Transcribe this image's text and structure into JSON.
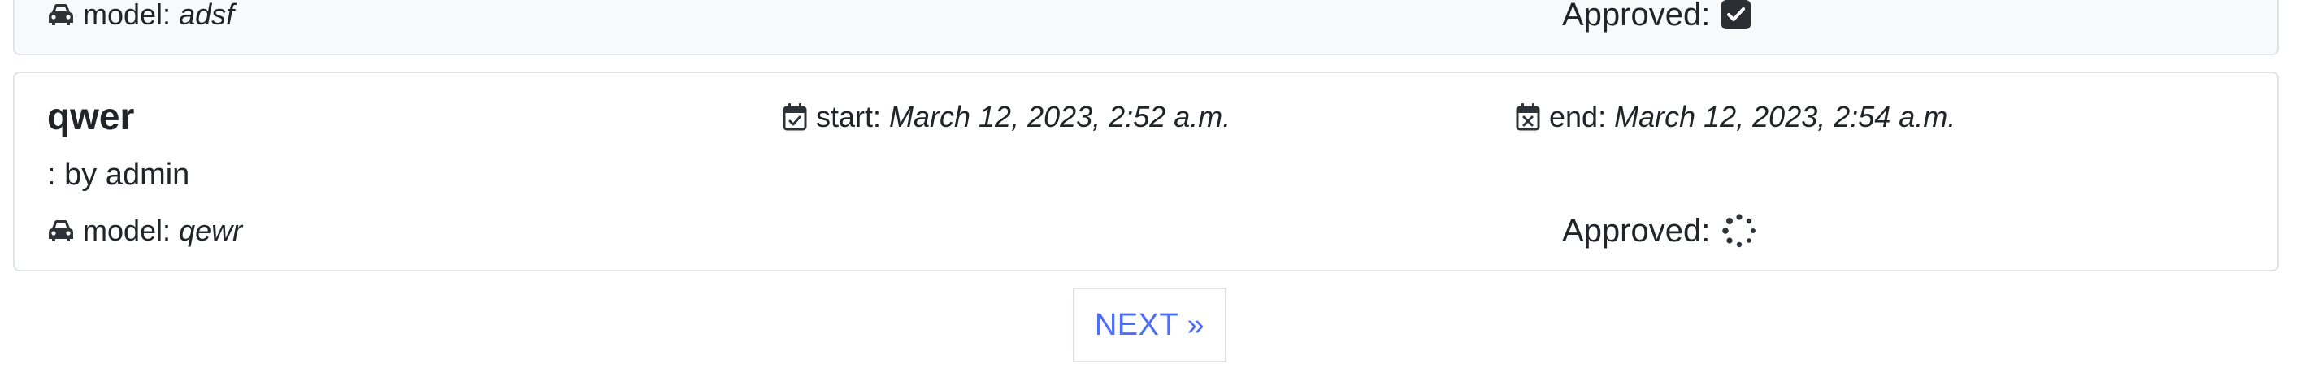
{
  "prev_item": {
    "model_label": "model:",
    "model_value": "adsf",
    "approved_label": "Approved:",
    "approved_state": "checked"
  },
  "item": {
    "title": "qwer",
    "start_label": "start:",
    "start_value": "March 12, 2023, 2:52 a.m.",
    "end_label": "end:",
    "end_value": "March 12, 2023, 2:54 a.m.",
    "byline": ": by admin",
    "model_label": "model:",
    "model_value": "qewr",
    "approved_label": "Approved:",
    "approved_state": "pending"
  },
  "pagination": {
    "next_label": "NEXT »"
  },
  "icons": {
    "car": "car-icon",
    "calendar_check": "calendar-check-icon",
    "calendar_x": "calendar-x-icon",
    "checkbox": "checkbox-checked-icon",
    "spinner": "spinner-icon"
  },
  "colors": {
    "link": "#4d6ef5",
    "border": "#dfe2e6",
    "card_bg_prev": "#f8f9fa",
    "text": "#212529"
  }
}
